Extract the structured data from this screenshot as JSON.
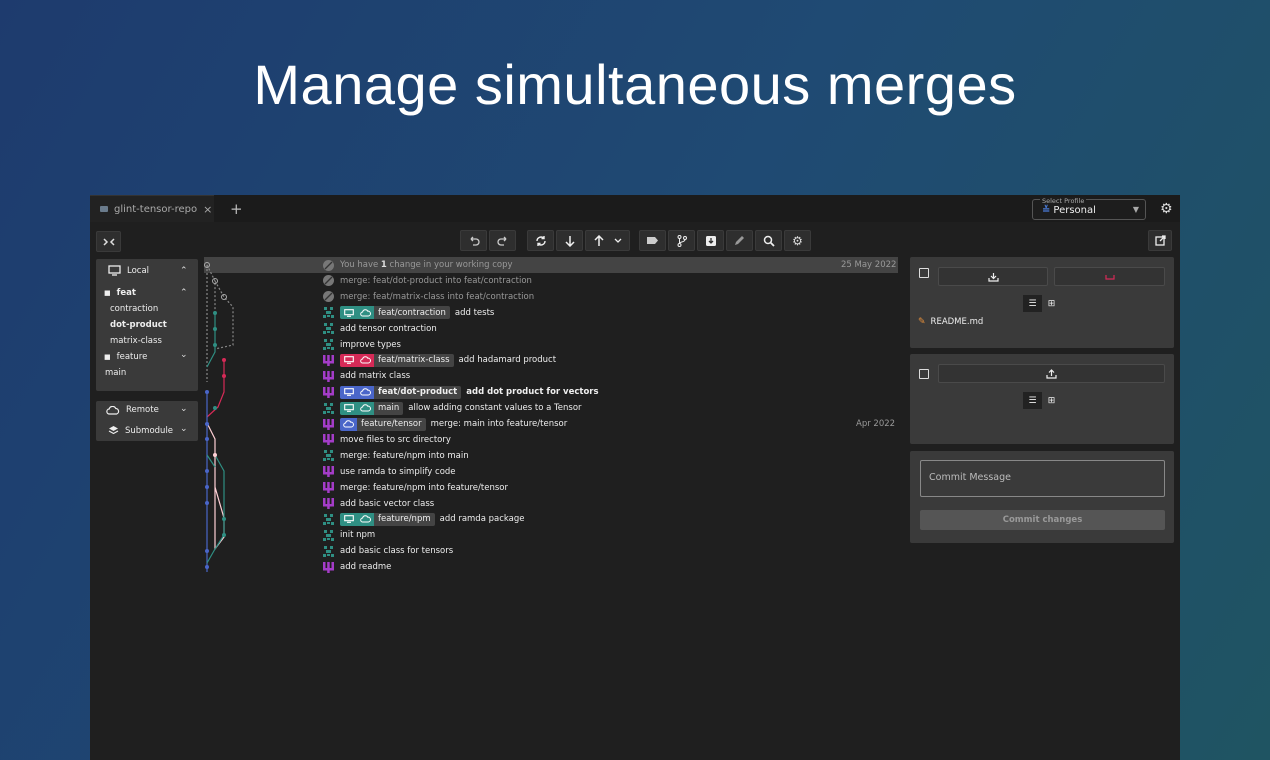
{
  "hero": {
    "title": "Manage simultaneous merges"
  },
  "tabs": [
    {
      "label": "glint-tensor-repo",
      "close": "×"
    }
  ],
  "add_tab": "+",
  "profile": {
    "label": "Select Profile",
    "value": "Personal"
  },
  "sidebar": {
    "local_label": "Local",
    "folders": [
      {
        "label": "feat",
        "children": [
          "contraction",
          "dot-product",
          "matrix-class"
        ]
      },
      {
        "label": "feature",
        "children": []
      }
    ],
    "branches": [
      "main"
    ],
    "remote_label": "Remote",
    "submodule_label": "Submodule"
  },
  "commits": [
    {
      "author": "none",
      "msg_parts": [
        "You have ",
        "1",
        " change in your working copy"
      ],
      "date": "25 May 2022",
      "dim": true
    },
    {
      "author": "none",
      "msg": "merge: feat/dot-product into feat/contraction",
      "dim": true
    },
    {
      "author": "none",
      "msg": "merge: feat/matrix-class into feat/contraction",
      "dim": true
    },
    {
      "author": "teal",
      "branch": "feat/contraction",
      "branch_color": "#2f8f83",
      "msg": "add tests"
    },
    {
      "author": "teal",
      "msg": "add tensor contraction"
    },
    {
      "author": "teal",
      "msg": "improve types"
    },
    {
      "author": "purple",
      "branch": "feat/matrix-class",
      "branch_color": "#d62a57",
      "msg": "add hadamard product"
    },
    {
      "author": "purple",
      "msg": "add matrix class"
    },
    {
      "author": "purple",
      "branch": "feat/dot-product",
      "branch_color": "#4a66c9",
      "msg": "add dot product for vectors",
      "bold": true
    },
    {
      "author": "teal",
      "branch": "main",
      "branch_color": "#2f8f83",
      "msg": "allow adding constant values to a Tensor"
    },
    {
      "author": "purple",
      "branch": "feature/tensor",
      "branch_color": "#4a66c9",
      "remote_only": true,
      "msg": "merge: main into feature/tensor",
      "date": "Apr 2022"
    },
    {
      "author": "purple",
      "msg": "move files to src directory"
    },
    {
      "author": "teal",
      "msg": "merge: feature/npm into main"
    },
    {
      "author": "purple",
      "msg": "use ramda to simplify code"
    },
    {
      "author": "purple",
      "msg": "merge: feature/npm into feature/tensor"
    },
    {
      "author": "purple",
      "msg": "add basic vector class"
    },
    {
      "author": "teal",
      "branch": "feature/npm",
      "branch_color": "#2f8f83",
      "msg": "add ramda package"
    },
    {
      "author": "teal",
      "msg": "init npm"
    },
    {
      "author": "teal",
      "msg": "add basic class for tensors"
    },
    {
      "author": "purple",
      "msg": "add readme"
    }
  ],
  "unstaged": {
    "files": [
      {
        "name": "README.md",
        "status": "modified"
      }
    ]
  },
  "commit": {
    "placeholder": "Commit Message",
    "button": "Commit changes"
  },
  "colors": {
    "teal": "#2f8f83",
    "purple": "#a43cc8",
    "red": "#d62a57",
    "blue": "#4a66c9"
  }
}
